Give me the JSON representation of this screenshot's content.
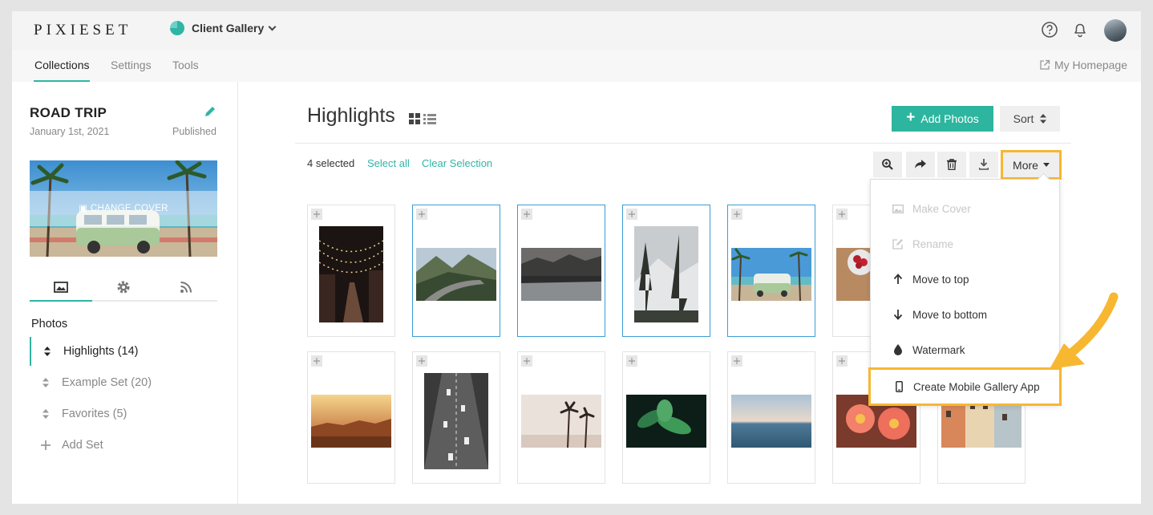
{
  "brand": {
    "logo": "PIXIESET"
  },
  "header": {
    "gallery_label": "Client Gallery"
  },
  "subnav": {
    "tabs": [
      {
        "label": "Collections"
      },
      {
        "label": "Settings"
      },
      {
        "label": "Tools"
      }
    ],
    "homepage_link": "My Homepage"
  },
  "collection": {
    "title": "ROAD TRIP",
    "date": "January 1st, 2021",
    "status": "Published",
    "cover_label": "CHANGE COVER"
  },
  "sidebar": {
    "section_heading": "Photos",
    "sets": [
      {
        "label": "Highlights (14)"
      },
      {
        "label": "Example Set (20)"
      },
      {
        "label": "Favorites (5)"
      }
    ],
    "add_set_label": "Add Set"
  },
  "main": {
    "title": "Highlights",
    "add_photos_label": "Add Photos",
    "sort_label": "Sort",
    "selection": {
      "count_text": "4 selected",
      "select_all": "Select all",
      "clear": "Clear Selection"
    },
    "more_label": "More"
  },
  "dropdown": {
    "items": [
      {
        "label": "Make Cover",
        "disabled": true
      },
      {
        "label": "Rename",
        "disabled": true
      },
      {
        "label": "Move to top",
        "disabled": false
      },
      {
        "label": "Move to bottom",
        "disabled": false
      },
      {
        "label": "Watermark",
        "disabled": false
      },
      {
        "label": "Create Mobile Gallery App",
        "disabled": false
      }
    ]
  },
  "colors": {
    "accent": "#2fb5a6",
    "selection_border": "#3a9ed5",
    "annotation": "#f7b731"
  }
}
